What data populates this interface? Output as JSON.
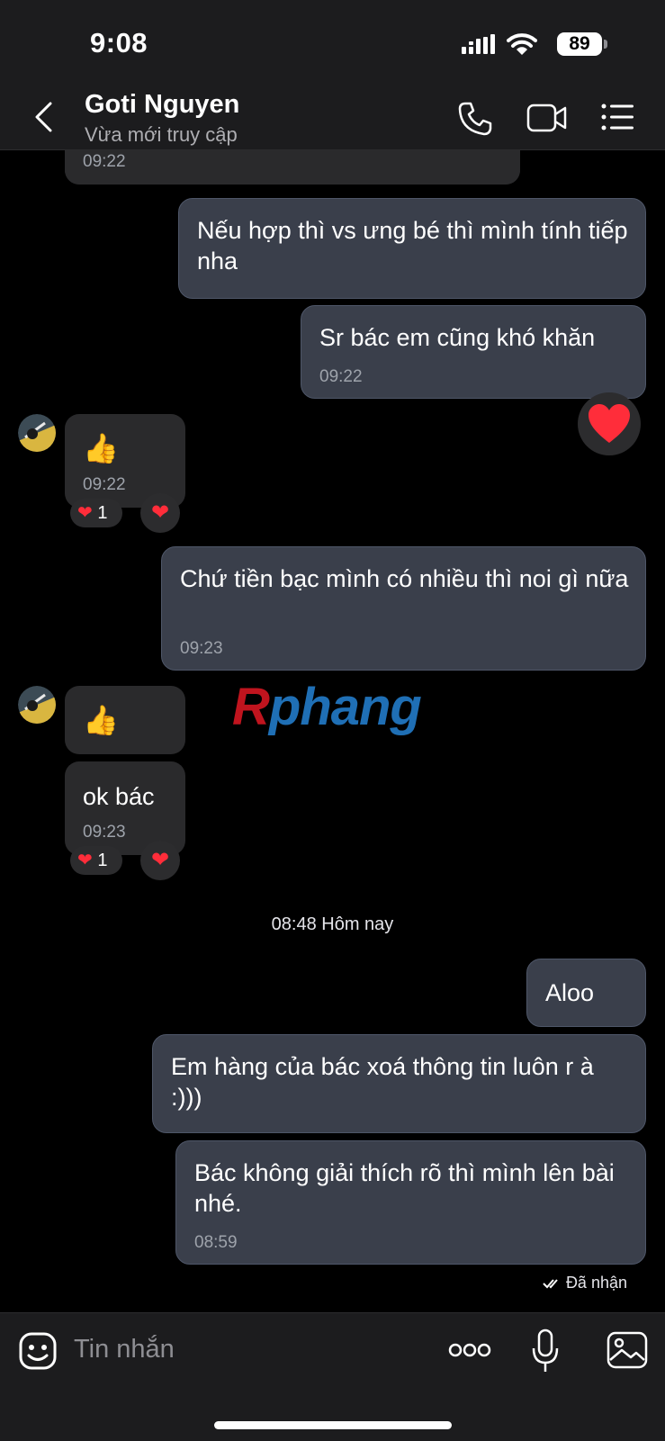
{
  "status_bar": {
    "time": "9:08",
    "battery": "89"
  },
  "header": {
    "contact_name": "Goti Nguyen",
    "contact_status": "Vừa mới truy cập"
  },
  "messages": {
    "m0_time": "09:22",
    "m1_text": "Nếu hợp thì vs ưng bé thì mình tính tiếp nha",
    "m2_text": "Sr bác em cũng khó khăn",
    "m2_time": "09:22",
    "m2_reaction": "❤",
    "m3_emoji": "👍",
    "m3_time": "09:22",
    "m3_reaction_count": "1",
    "m4_text": "Chứ tiền bạc mình có nhiều thì noi gì nữa",
    "m4_time": "09:23",
    "m5_emoji": "👍",
    "m6_text": "ok bác",
    "m6_time": "09:23",
    "m6_reaction_count": "1",
    "divider": "08:48 Hôm nay",
    "m7_text": "Aloo",
    "m8_text": "Em hàng của bác xoá thông tin luôn r à :)))",
    "m9_text": "Bác không giải thích rõ thì mình lên bài nhé.",
    "m9_time": "08:59",
    "received_status": "Đã nhận"
  },
  "watermark": {
    "part1": "R",
    "part2": "phang"
  },
  "input": {
    "placeholder": "Tin nhắn"
  },
  "icons": {
    "back": "chevron-left-icon",
    "call": "phone-icon",
    "video": "video-camera-icon",
    "menu": "list-icon",
    "sticker": "sticker-face-icon",
    "more": "more-dots-icon",
    "mic": "microphone-icon",
    "gallery": "image-icon"
  },
  "colors": {
    "background": "#000000",
    "bar": "#1c1c1e",
    "outgoing_bubble": "#3a3f4b",
    "incoming_bubble": "#2a2a2c",
    "heart": "#ff2d3a"
  }
}
